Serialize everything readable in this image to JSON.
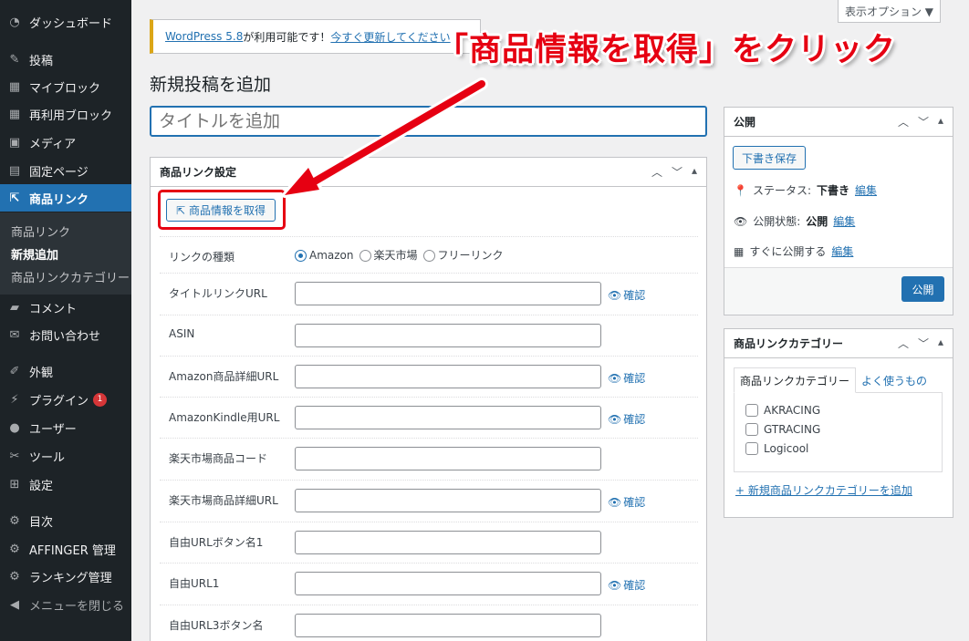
{
  "sidebar": {
    "items": [
      {
        "label": "ダッシュボード",
        "icon": "dashboard-icon"
      },
      {
        "label": "投稿",
        "icon": "pin-icon"
      },
      {
        "label": "マイブロック",
        "icon": "block-icon"
      },
      {
        "label": "再利用ブロック",
        "icon": "block-icon"
      },
      {
        "label": "メディア",
        "icon": "media-icon"
      },
      {
        "label": "固定ページ",
        "icon": "page-icon"
      },
      {
        "label": "商品リンク",
        "icon": "share-icon"
      },
      {
        "label": "コメント",
        "icon": "comment-icon"
      },
      {
        "label": "お問い合わせ",
        "icon": "mail-icon"
      },
      {
        "label": "外観",
        "icon": "brush-icon"
      },
      {
        "label": "プラグイン",
        "icon": "plugin-icon"
      },
      {
        "label": "ユーザー",
        "icon": "user-icon"
      },
      {
        "label": "ツール",
        "icon": "wrench-icon"
      },
      {
        "label": "設定",
        "icon": "settings-icon"
      },
      {
        "label": "目次",
        "icon": "gear-icon"
      },
      {
        "label": "AFFINGER 管理",
        "icon": "gear-icon"
      },
      {
        "label": "ランキング管理",
        "icon": "gear-icon"
      },
      {
        "label": "メニューを閉じる",
        "icon": "collapse-icon"
      }
    ],
    "submenu": [
      "商品リンク",
      "新規追加",
      "商品リンクカテゴリー"
    ],
    "plugin_badge": "1"
  },
  "screen_options": "表示オプション ▼",
  "notice": {
    "link1": "WordPress 5.8",
    "text": " が利用可能です！",
    "link2": "今すぐ更新してください"
  },
  "page_title": "新規投稿を追加",
  "title_placeholder": "タイトルを追加",
  "link_box": {
    "title": "商品リンク設定",
    "fetch_button": "商品情報を取得",
    "link_type_label": "リンクの種類",
    "radio_options": [
      "Amazon",
      "楽天市場",
      "フリーリンク"
    ],
    "check_label": "確認",
    "fields": [
      {
        "label": "タイトルリンクURL",
        "check": true
      },
      {
        "label": "ASIN",
        "check": false
      },
      {
        "label": "Amazon商品詳細URL",
        "check": true
      },
      {
        "label": "AmazonKindle用URL",
        "check": true
      },
      {
        "label": "楽天市場商品コード",
        "check": false
      },
      {
        "label": "楽天市場商品詳細URL",
        "check": true
      },
      {
        "label": "自由URLボタン名1",
        "check": false
      },
      {
        "label": "自由URL1",
        "check": true
      },
      {
        "label": "自由URL3ボタン名",
        "check": false
      }
    ]
  },
  "publish_box": {
    "title": "公開",
    "draft_button": "下書き保存",
    "status_label": "ステータス:",
    "status_value": "下書き",
    "visibility_label": "公開状態:",
    "visibility_value": "公開",
    "schedule_label": "すぐに公開する",
    "edit_link": "編集",
    "publish_button": "公開"
  },
  "category_box": {
    "title": "商品リンクカテゴリー",
    "tab_all": "商品リンクカテゴリー",
    "tab_popular": "よく使うもの",
    "categories": [
      "AKRACING",
      "GTRACING",
      "Logicool"
    ],
    "add_link": "+ 新規商品リンクカテゴリーを追加"
  },
  "annotation": {
    "text": "「商品情報を取得」をクリック",
    "color": "#e60012"
  },
  "colors": {
    "sidebar_bg": "#1d2327",
    "accent": "#2271b1",
    "highlight": "#e60012"
  }
}
